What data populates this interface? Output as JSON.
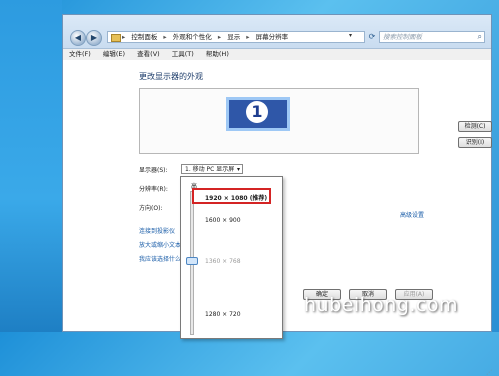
{
  "window": {
    "breadcrumb": [
      "控制面板",
      "外观和个性化",
      "显示",
      "屏幕分辨率"
    ],
    "search_placeholder": "搜索控制面板"
  },
  "menu": [
    "文件(F)",
    "编辑(E)",
    "查看(V)",
    "工具(T)",
    "帮助(H)"
  ],
  "main": {
    "title": "更改显示器的外观",
    "monitor_number": "1",
    "detect_label": "检测(C)",
    "identify_label": "识别(I)",
    "display_label": "显示器(S):",
    "display_value": "1. 移动 PC 显示屏",
    "resolution_label": "分辨率(R):",
    "orientation_label": "方向(O):",
    "advanced_link": "高级设置",
    "links": [
      "连接到投影仪",
      "放大或缩小文本",
      "我应该选择什么"
    ],
    "ok_label": "确定",
    "cancel_label": "取消",
    "apply_label": "应用(A)"
  },
  "resolution_popup": {
    "high_label": "高",
    "options": [
      "1920 × 1080 (推荐)",
      "1600 × 900",
      "1360 × 768",
      "1280 × 720"
    ],
    "selected_index": 0
  },
  "watermark": "hubeihong.com"
}
